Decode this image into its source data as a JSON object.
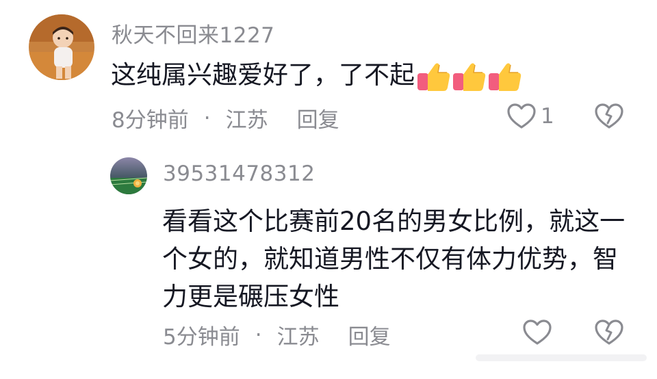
{
  "comments": [
    {
      "username": "秋天不回来1227",
      "text": "这纯属兴趣爱好了，了不起",
      "emoji_icons": [
        "thumbs-up-icon",
        "thumbs-up-icon",
        "thumbs-up-icon"
      ],
      "time": "8分钟前",
      "separator": "·",
      "location": "江苏",
      "reply_label": "回复",
      "like_count": "1"
    },
    {
      "username": "39531478312",
      "text": "看看这个比赛前20名的男女比例，就这一个女的，就知道男性不仅有体力优势，智力更是碾压女性",
      "time": "5分钟前",
      "separator": "·",
      "location": "江苏",
      "reply_label": "回复",
      "like_count": ""
    }
  ],
  "icons": {
    "like": "heart-outline-icon",
    "dislike": "broken-heart-outline-icon"
  },
  "colors": {
    "text": "#161823",
    "meta": "#8a8b91",
    "background": "#ffffff"
  }
}
